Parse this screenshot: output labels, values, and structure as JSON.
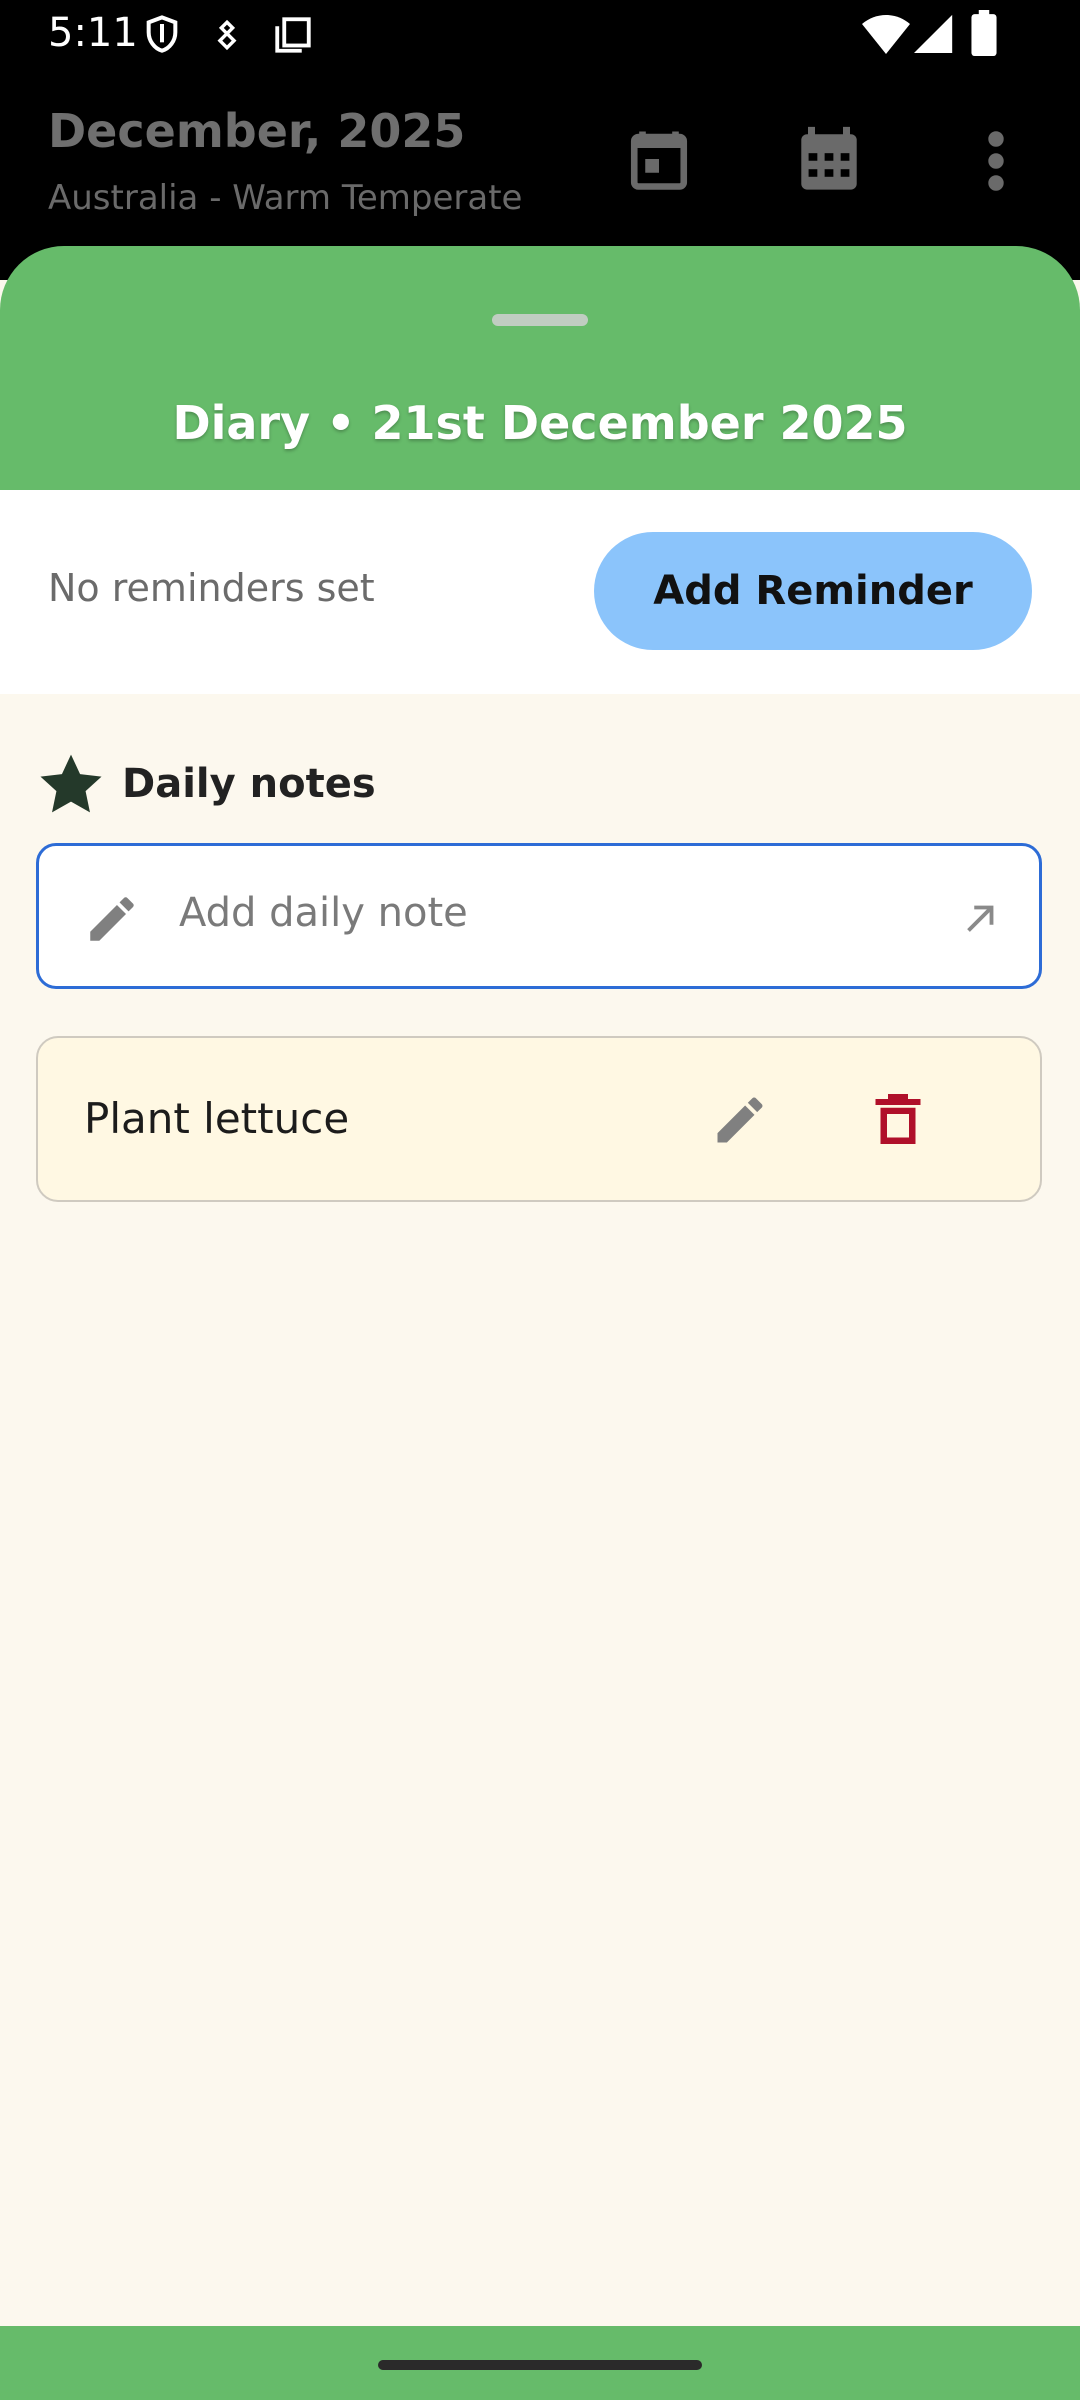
{
  "status_bar": {
    "time": "5:11",
    "icons": [
      "shield-icon",
      "usb-icon",
      "copy-icon",
      "wifi-icon",
      "signal-icon",
      "battery-icon"
    ]
  },
  "app_bar": {
    "title": "December, 2025",
    "subtitle": "Australia - Warm Temperate",
    "actions": [
      "calendar-today-icon",
      "calendar-month-icon",
      "more-vert-icon"
    ]
  },
  "sheet": {
    "title": "Diary •  21st December 2025",
    "header_color": "#66bb6a"
  },
  "reminders": {
    "status_text": "No reminders set",
    "add_button_label": "Add Reminder",
    "button_color": "#8bc4fb"
  },
  "daily_notes": {
    "heading": "Daily notes",
    "heading_icon": "star-icon",
    "input_placeholder": "Add daily note",
    "notes": [
      {
        "text": "Plant lettuce"
      }
    ]
  },
  "colors": {
    "background": "#fcf8ee",
    "accent_blue": "#2d6cd6",
    "delete_red": "#b0102a"
  }
}
